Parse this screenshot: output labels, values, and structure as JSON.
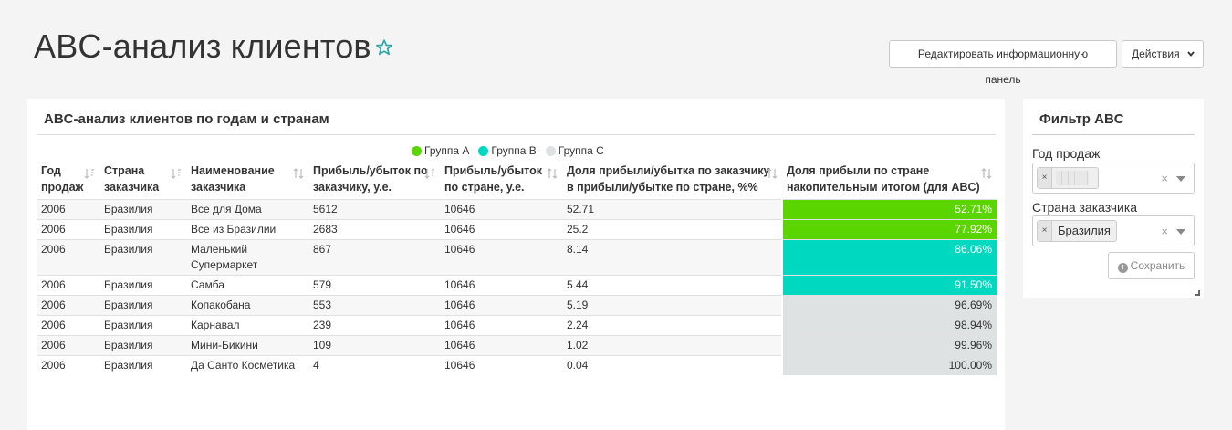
{
  "page": {
    "title": "ABC-анализ клиентов",
    "edit_button": "Редактировать информационную панель",
    "actions_button": "Действия"
  },
  "colors": {
    "group_a": "#5ad500",
    "group_b": "#00d9c0",
    "group_c": "#dee2e2",
    "star": "#2aa7a7"
  },
  "main_panel": {
    "title": "ABC-анализ клиентов по годам и странам",
    "legend": [
      "Группа A",
      "Группа B",
      "Группа C"
    ],
    "columns": [
      "Год продаж",
      "Страна заказчика",
      "Наименование заказчика",
      "Прибыль/убыток по заказчику, у.е.",
      "Прибыль/убыток по стране, у.е.",
      "Доля прибыли/убытка по заказчику в прибыли/убытке по стране, %%",
      "Доля прибыли по стране накопительным итогом (для ABC)"
    ],
    "rows": [
      {
        "year": "2006",
        "country": "Бразилия",
        "customer": "Все для Дома",
        "profit": "5612",
        "country_profit": "10646",
        "share": "52.71",
        "cumulative": "52.71%",
        "group": "A"
      },
      {
        "year": "2006",
        "country": "Бразилия",
        "customer": "Все из Бразилии",
        "profit": "2683",
        "country_profit": "10646",
        "share": "25.2",
        "cumulative": "77.92%",
        "group": "A"
      },
      {
        "year": "2006",
        "country": "Бразилия",
        "customer": "Маленький Супермаркет",
        "profit": "867",
        "country_profit": "10646",
        "share": "8.14",
        "cumulative": "86.06%",
        "group": "B"
      },
      {
        "year": "2006",
        "country": "Бразилия",
        "customer": "Самба",
        "profit": "579",
        "country_profit": "10646",
        "share": "5.44",
        "cumulative": "91.50%",
        "group": "B"
      },
      {
        "year": "2006",
        "country": "Бразилия",
        "customer": "Копакобана",
        "profit": "553",
        "country_profit": "10646",
        "share": "5.19",
        "cumulative": "96.69%",
        "group": "C"
      },
      {
        "year": "2006",
        "country": "Бразилия",
        "customer": "Карнавал",
        "profit": "239",
        "country_profit": "10646",
        "share": "2.24",
        "cumulative": "98.94%",
        "group": "C"
      },
      {
        "year": "2006",
        "country": "Бразилия",
        "customer": "Мини-Бикини",
        "profit": "109",
        "country_profit": "10646",
        "share": "1.02",
        "cumulative": "99.96%",
        "group": "C"
      },
      {
        "year": "2006",
        "country": "Бразилия",
        "customer": "Да Санто Косметика",
        "profit": "4",
        "country_profit": "10646",
        "share": "0.04",
        "cumulative": "100.00%",
        "group": "C"
      }
    ]
  },
  "filter_panel": {
    "title": "Фильтр ABC",
    "year_label": "Год продаж",
    "country_label": "Страна заказчика",
    "country_value": "Бразилия",
    "tag_remove": "×",
    "clear": "×",
    "save_label": "Сохранить"
  }
}
